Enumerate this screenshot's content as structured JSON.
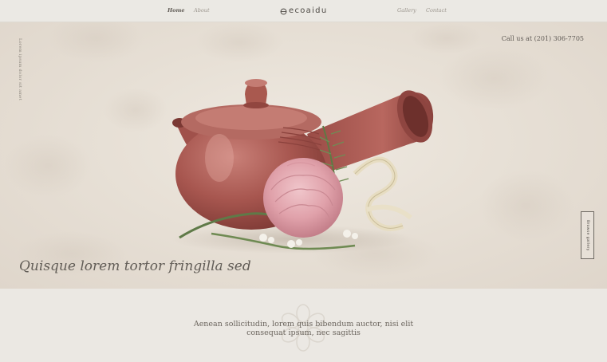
{
  "nav": {
    "left": [
      "Home",
      "About"
    ],
    "right": [
      "Gallery",
      "Contact"
    ],
    "active": "Home"
  },
  "logo": {
    "text": "ecoaidu",
    "icon": "flower-logo-icon"
  },
  "hero": {
    "phone": "Call us at (201) 306-7705",
    "side_text": "Lorem ipsum dolor sit amet",
    "heading": "Quisque lorem tortor fringilla sed",
    "side_button": "Browse gallery",
    "image": "teapot-with-flowers"
  },
  "tagline": {
    "line1": "Aenean sollicitudin, lorem quis bibendum auctor, nisi elit",
    "line2": "consequat ipsum, nec sagittis"
  },
  "colors": {
    "background": "#ebe8e2",
    "teapot": "#a85a55",
    "text": "#5b5650"
  }
}
